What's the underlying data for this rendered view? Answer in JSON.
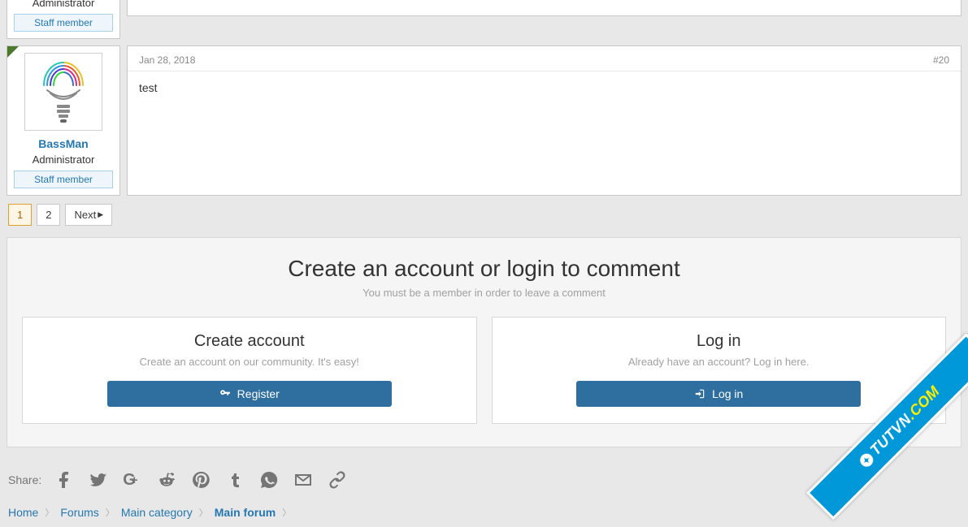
{
  "posts": [
    {
      "userRole": "Administrator",
      "userBadge": "Staff member"
    },
    {
      "userName": "BassMan",
      "userRole": "Administrator",
      "userBadge": "Staff member",
      "date": "Jan 28, 2018",
      "number": "#20",
      "content": "test"
    }
  ],
  "pagination": {
    "current": "1",
    "next_page": "2",
    "next_label": "Next"
  },
  "cta": {
    "title": "Create an account or login to comment",
    "subtitle": "You must be a member in order to leave a comment",
    "create": {
      "title": "Create account",
      "subtitle": "Create an account on our community. It's easy!",
      "button": "Register"
    },
    "login": {
      "title": "Log in",
      "subtitle": "Already have an account? Log in here.",
      "button": "Log in"
    }
  },
  "share": {
    "label": "Share:"
  },
  "breadcrumb": [
    {
      "label": "Home"
    },
    {
      "label": "Forums"
    },
    {
      "label": "Main category"
    },
    {
      "label": "Main forum",
      "current": true
    }
  ],
  "watermark": {
    "text1": "TUTVN",
    "text2": ".COM"
  }
}
